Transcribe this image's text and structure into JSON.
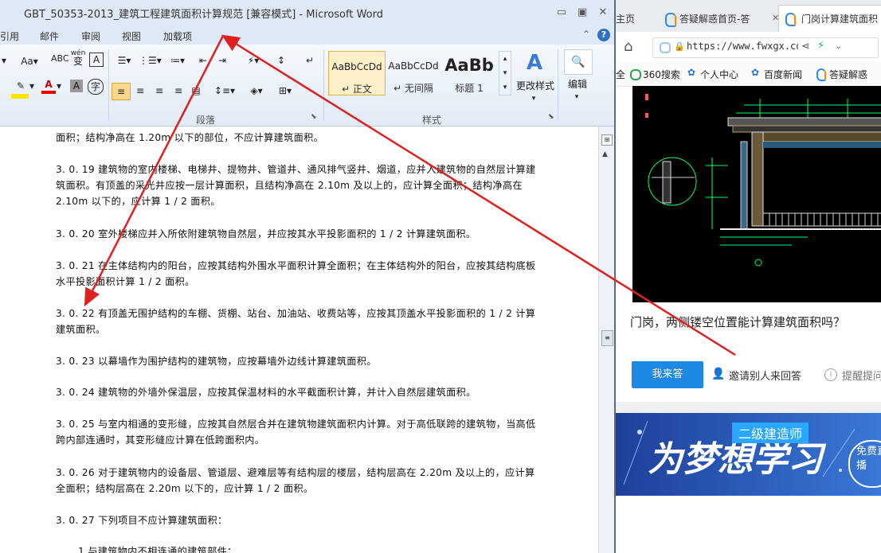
{
  "word": {
    "title": "GBT_50353-2013_建筑工程建筑面积计算规范 [兼容模式] - Microsoft Word",
    "window_buttons": [
      "▭",
      "▣",
      "✕"
    ],
    "ribbon_tabs": [
      "引用",
      "邮件",
      "审阅",
      "视图",
      "加载项"
    ],
    "font_controls": {
      "aa": "Aa▾",
      "pinyin": "wén",
      "char_border": "A",
      "highlight_arrow": "▾",
      "font_color": "A",
      "char_shading": "A",
      "enclose": "字"
    },
    "styles": [
      {
        "sample": "AaBbCcDd",
        "name": "↵ 正文"
      },
      {
        "sample": "AaBbCcDd",
        "name": "↵ 无间隔"
      },
      {
        "sample": "AaBb",
        "name": "标题 1"
      }
    ],
    "change_styles_label": "更改样式",
    "edit_label": "编辑",
    "group_paragraph": "段落",
    "group_styles": "样式",
    "paragraphs": [
      "面积；结构净高在 1.20m 以下的部位，不应计算建筑面积。",
      "3. 0. 19  建筑物的室内楼梯、电梯井、提物井、管道井、通风排气竖井、烟道，应并入建筑物的自然层计算建筑面积。有顶盖的采光井应按一层计算面积，且结构净高在 2.10m 及以上的，应计算全面积；结构净高在 2.10m 以下的，应计算 1 / 2 面积。",
      "3. 0. 20  室外楼梯应并入所依附建筑物自然层，并应按其水平投影面积的 1 / 2 计算建筑面积。",
      "3. 0. 21  在主体结构内的阳台，应按其结构外围水平面积计算全面积；在主体结构外的阳台，应按其结构底板水平投影面积计算 1 / 2 面积。",
      "3. 0. 22  有顶盖无围护结构的车棚、货棚、站台、加油站、收费站等，应按其顶盖水平投影面积的 1 / 2 计算建筑面积。",
      "3. 0. 23  以幕墙作为围护结构的建筑物，应按幕墙外边线计算建筑面积。",
      "3. 0. 24  建筑物的外墙外保温层，应按其保温材料的水平截面积计算，并计入自然层建筑面积。",
      "3. 0. 25  与室内相通的变形缝，应按其自然层合并在建筑物建筑面积内计算。对于高低联跨的建筑物，当高低跨内部连通时，其变形缝应计算在低跨面积内。",
      "3. 0. 26  对于建筑物内的设备层、管道层、避难层等有结构层的楼层，结构层高在 2.20m 及以上的，应计算全面积；结构层高在 2.20m 以下的，应计算 1 / 2 面积。",
      "3. 0. 27 下列项目不应计算建筑面积：",
      "1  与建筑物内不相连通的建筑部件；"
    ]
  },
  "browser": {
    "tabs": [
      "主页",
      "答疑解惑首页-答",
      "门岗计算建筑面积"
    ],
    "url": "https://www.fwxgx.co",
    "bookmarks": [
      "全",
      "360搜索",
      "个人中心",
      "百度新闻",
      "答疑解惑"
    ],
    "question": "门岗，两侧镂空位置能计算建筑面积吗？",
    "answer_button": "我来答",
    "invite_label": "邀请别人来回答",
    "remind_label": "提醒提问",
    "ad": {
      "badge": "二级建造师",
      "big_text": "为梦想学习",
      "circle_text": "免费直播"
    }
  },
  "colors": {
    "accent_blue": "#1e88e5",
    "annotation_red": "#e02020",
    "cad_green": "#00ff66",
    "word_ribbon": "#dfe9f5"
  }
}
